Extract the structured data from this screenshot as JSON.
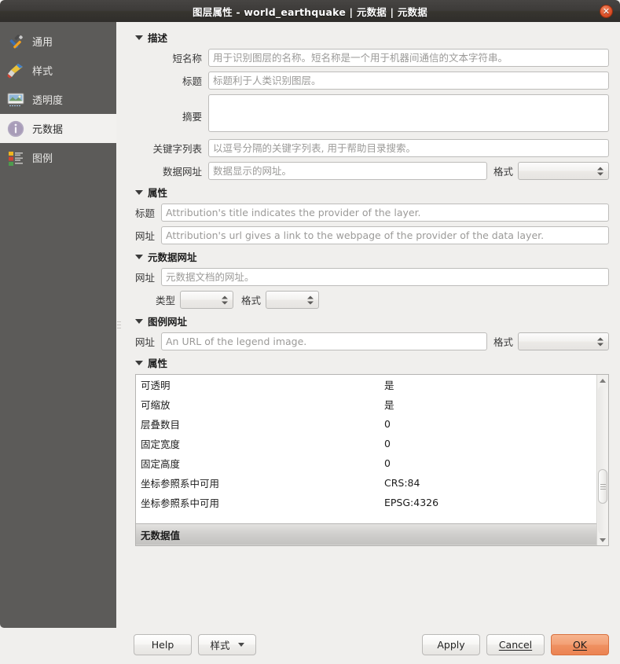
{
  "window": {
    "title": "图层属性 - world_earthquake | 元数据 | 元数据",
    "close_icon": "close-icon"
  },
  "sidebar": {
    "items": [
      {
        "label": "通用",
        "icon": "tools-icon",
        "active": false
      },
      {
        "label": "样式",
        "icon": "paintbrush-icon",
        "active": false
      },
      {
        "label": "透明度",
        "icon": "image-icon",
        "active": false
      },
      {
        "label": "元数据",
        "icon": "info-circle-icon",
        "active": true
      },
      {
        "label": "图例",
        "icon": "legend-icon",
        "active": false
      }
    ]
  },
  "description": {
    "group_title": "描述",
    "short_name_label": "短名称",
    "short_name_value": "",
    "short_name_placeholder": "用于识别图层的名称。短名称是一个用于机器间通信的文本字符串。",
    "title_label": "标题",
    "title_value": "",
    "title_placeholder": "标题利于人类识别图层。",
    "abstract_label": "摘要",
    "abstract_value": "",
    "abstract_placeholder": "",
    "keywords_label": "关键字列表",
    "keywords_value": "",
    "keywords_placeholder": "以逗号分隔的关键字列表, 用于帮助目录搜索。",
    "dataurl_label": "数据网址",
    "dataurl_value": "",
    "dataurl_placeholder": "数据显示的网址。",
    "format_label": "格式",
    "format_value": ""
  },
  "attribution": {
    "group_title": "属性",
    "title_label": "标题",
    "title_value": "",
    "title_placeholder": "Attribution's title indicates the provider of the layer.",
    "url_label": "网址",
    "url_value": "",
    "url_placeholder": "Attribution's url gives a link to the webpage of the provider of the data layer."
  },
  "metadata_url": {
    "group_title": "元数据网址",
    "url_label": "网址",
    "url_value": "",
    "url_placeholder": "元数据文档的网址。",
    "type_label": "类型",
    "type_value": "",
    "format_label": "格式",
    "format_value": ""
  },
  "legend_url": {
    "group_title": "图例网址",
    "url_label": "网址",
    "url_value": "",
    "url_placeholder": "An URL of the legend image.",
    "format_label": "格式",
    "format_value": ""
  },
  "properties": {
    "group_title": "属性",
    "rows": [
      {
        "key": "可透明",
        "value": "是"
      },
      {
        "key": "可缩放",
        "value": "是"
      },
      {
        "key": "层叠数目",
        "value": "0"
      },
      {
        "key": "固定宽度",
        "value": "0"
      },
      {
        "key": "固定高度",
        "value": "0"
      },
      {
        "key": "坐标参照系中可用",
        "value": "CRS:84"
      },
      {
        "key": "坐标参照系中可用",
        "value": "EPSG:4326"
      }
    ],
    "section_row": "无数据值"
  },
  "buttons": {
    "help": "Help",
    "style": "样式",
    "apply": "Apply",
    "cancel": "Cancel",
    "ok": "OK"
  },
  "colors": {
    "titlebar": "#3a3836",
    "sidebar": "#5c5b59",
    "content_bg": "#f0efed",
    "accent_ok": "#ef9162",
    "close_btn": "#e0522a"
  }
}
